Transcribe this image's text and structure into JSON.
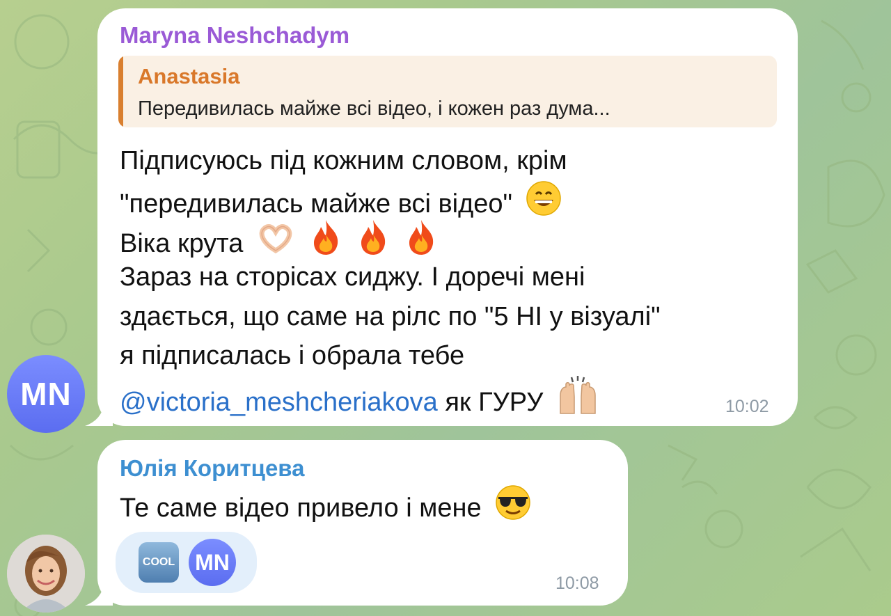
{
  "messages": [
    {
      "sender": "Maryna Neshchadym",
      "sender_color": "#9a5ad6",
      "avatar_initials": "MN",
      "reply": {
        "author": "Anastasia",
        "text": "Передивилась майже всі відео, і кожен раз дума..."
      },
      "lines": {
        "l1": "Підписуюсь під кожним словом, крім",
        "l2": "\"передивилась майже всі відео\"",
        "l3": "Віка крута",
        "l4": "Зараз на сторісах сиджу. І доречі мені",
        "l5": "здається, що саме на рілс по \"5 НІ у візуалі\"",
        "l6": "я підписалась і обрала тебе",
        "mention": "@victoria_meshcheriakova",
        "l7_tail": " як ГУРУ"
      },
      "time": "10:02"
    },
    {
      "sender": "Юлія Коритцева",
      "sender_color": "#3d8fd1",
      "text": "Те саме відео привело і мене",
      "reaction": {
        "badge_text": "COOL",
        "reactor_initials": "MN"
      },
      "time": "10:08"
    }
  ],
  "icons": {
    "grin": "grinning-face-icon",
    "hands_heart": "heart-hands-icon",
    "fire": "fire-icon",
    "raised_hands": "raising-hands-icon",
    "sunglasses": "sunglasses-face-icon"
  },
  "colors": {
    "accent_link": "#2a70c9",
    "reply_bar": "#d97f2f",
    "reaction_pill": "#e3effb"
  }
}
